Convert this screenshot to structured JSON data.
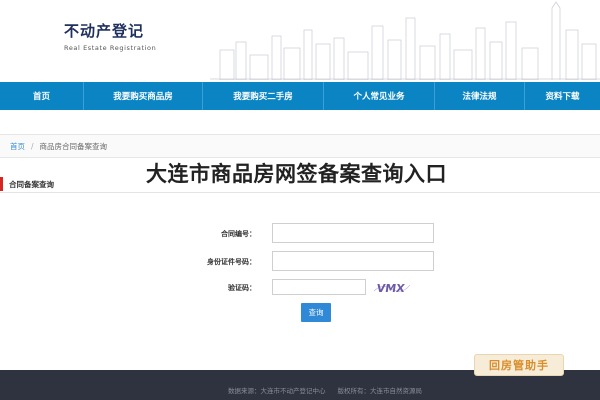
{
  "header": {
    "title": "不动产登记",
    "subtitle": "Real Estate Registration"
  },
  "nav": {
    "items": [
      "首页",
      "我要购买商品房",
      "我要购买二手房",
      "个人常见业务",
      "法律法规",
      "资料下载"
    ]
  },
  "breadcrumb": {
    "home": "首页",
    "separator": "/",
    "current": "商品房合同备案查询"
  },
  "page_title": "大连市商品房网签备案查询入口",
  "section": {
    "label": "合同备案查询"
  },
  "form": {
    "contract_label": "合同编号：",
    "contract_value": "",
    "id_label": "身份证件号码：",
    "id_value": "",
    "captcha_label": "验证码：",
    "captcha_value": "",
    "captcha_text": "VMX",
    "submit_label": "查询"
  },
  "footer": {
    "source": "数据来源：大连市不动产登记中心",
    "copyright": "版权所有：大连市自然资源局"
  },
  "watermark": "回房管助手",
  "colors": {
    "nav_bg": "#0a84c3",
    "accent_red": "#d6261f",
    "button_blue": "#2f89d6",
    "footer_bg": "#2f3340"
  }
}
